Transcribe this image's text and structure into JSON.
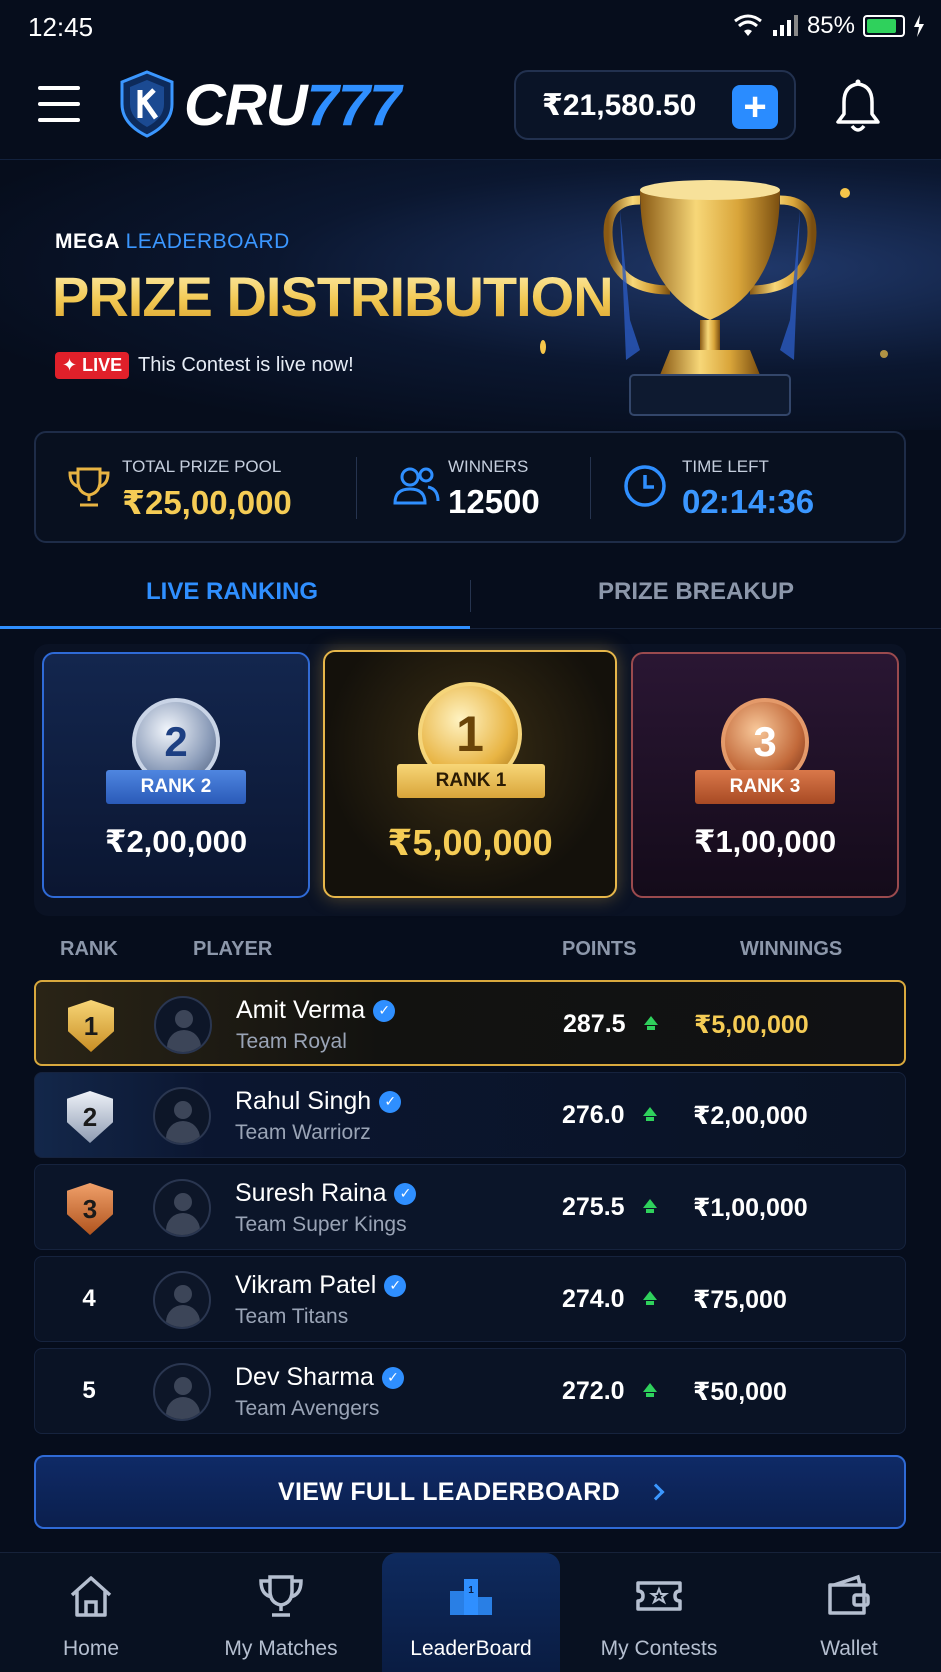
{
  "status": {
    "time": "12:45",
    "battery": "85%",
    "battery_level": 0.85
  },
  "header": {
    "logo_part1": "CRU",
    "logo_part2": "777",
    "balance": "₹21,580.50",
    "add_label": "+"
  },
  "hero": {
    "subtitle_part1": "MEGA",
    "subtitle_part2": "LEADERBOARD",
    "title": "PRIZE DISTRIBUTION",
    "live_badge": "✦ LIVE",
    "live_text": "This Contest is live now!"
  },
  "stats": {
    "prize_pool_label": "TOTAL PRIZE POOL",
    "prize_pool_value": "₹25,00,000",
    "winners_label": "WINNERS",
    "winners_value": "12500",
    "time_left_label": "TIME LEFT",
    "time_left_value": "02:14:36"
  },
  "tabs": {
    "live_ranking": "LIVE RANKING",
    "prize_breakup": "PRIZE BREAKUP"
  },
  "podium": {
    "rank2": {
      "medal": "2",
      "label": "RANK 2",
      "amount": "₹2,00,000"
    },
    "rank1": {
      "medal": "1",
      "label": "RANK 1",
      "amount": "₹5,00,000"
    },
    "rank3": {
      "medal": "3",
      "label": "RANK 3",
      "amount": "₹1,00,000"
    }
  },
  "table": {
    "headers": {
      "rank": "RANK",
      "player": "PLAYER",
      "points": "POINTS",
      "winnings": "WINNINGS"
    },
    "rows": [
      {
        "rank": "1",
        "name": "Amit Verma",
        "team": "Team Royal",
        "points": "287.5",
        "winnings": "₹5,00,000"
      },
      {
        "rank": "2",
        "name": "Rahul Singh",
        "team": "Team Warriorz",
        "points": "276.0",
        "winnings": "₹2,00,000"
      },
      {
        "rank": "3",
        "name": "Suresh Raina",
        "team": "Team Super Kings",
        "points": "275.5",
        "winnings": "₹1,00,000"
      },
      {
        "rank": "4",
        "name": "Vikram Patel",
        "team": "Team Titans",
        "points": "274.0",
        "winnings": "₹75,000"
      },
      {
        "rank": "5",
        "name": "Dev Sharma",
        "team": "Team Avengers",
        "points": "272.0",
        "winnings": "₹50,000"
      }
    ]
  },
  "view_full_label": "VIEW FULL LEADERBOARD",
  "nav": {
    "home": "Home",
    "my_matches": "My Matches",
    "leaderboard": "LeaderBoard",
    "my_contests": "My Contests",
    "wallet": "Wallet"
  },
  "colors": {
    "accent": "#2f8fff",
    "gold": "#f5cc55",
    "live": "#e0202a",
    "up": "#2fd15c"
  }
}
